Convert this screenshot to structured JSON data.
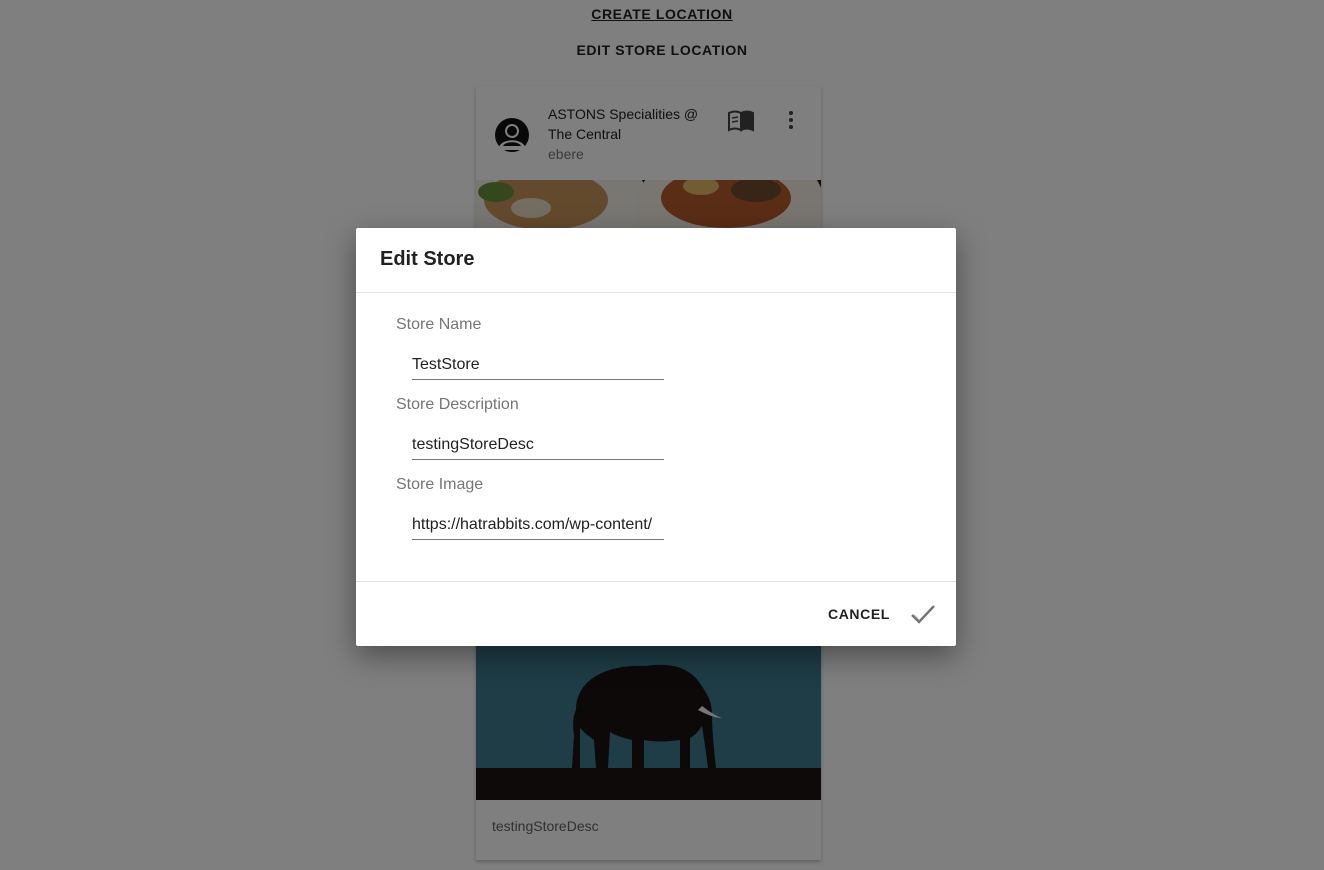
{
  "header": {
    "create_location": "CREATE LOCATION",
    "edit_store_location": "EDIT STORE LOCATION"
  },
  "store_card": {
    "title": "ASTONS Specialities @ The Central",
    "subtitle": "ebere",
    "avatar_icon": "account-circle-icon",
    "menu_icon": "menu-book-icon",
    "more_icon": "more-vert-icon"
  },
  "store_card_2": {
    "description": "testingStoreDesc"
  },
  "dialog": {
    "title": "Edit Store",
    "fields": [
      {
        "label": "Store Name",
        "value": "TestStore"
      },
      {
        "label": "Store Description",
        "value": "testingStoreDesc"
      },
      {
        "label": "Store Image",
        "value": "https://hatrabbits.com/wp-content/"
      }
    ],
    "cancel_label": "CANCEL",
    "confirm_icon": "check-icon"
  }
}
